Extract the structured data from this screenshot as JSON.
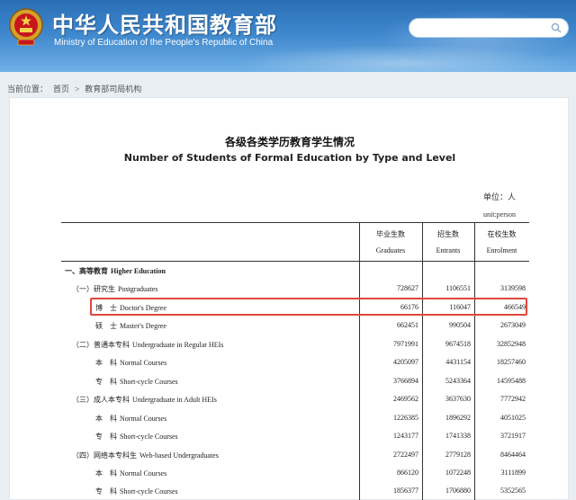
{
  "header": {
    "site_title_cn": "中华人民共和国教育部",
    "site_title_en": "Ministry of Education of the People's Republic of China",
    "search_placeholder": ""
  },
  "breadcrumb": {
    "prefix": "当前位置：",
    "items": [
      "首页",
      "教育部司局机构"
    ],
    "separator": ">"
  },
  "page": {
    "title_cn": "各级各类学历教育学生情况",
    "title_en": "Number of Students of Formal Education by Type and Level",
    "unit_cn": "单位：人",
    "unit_en": "unit:person"
  },
  "table": {
    "columns": [
      {
        "cn": "毕业生数",
        "en": "Graduates"
      },
      {
        "cn": "招生数",
        "en": "Entrants"
      },
      {
        "cn": "在校生数",
        "en": "Enrolment"
      }
    ],
    "rows": [
      {
        "label_cn": "一、高等教育",
        "label_en": "Higher Education",
        "graduates": "",
        "entrants": "",
        "enrolment": "",
        "indent": 0,
        "bold": true
      },
      {
        "label_cn": "（一）研究生",
        "label_en": "Postgraduates",
        "graduates": "728627",
        "entrants": "1106551",
        "enrolment": "3139598",
        "indent": 1,
        "bold": false
      },
      {
        "label_cn": "博　士",
        "label_en": "Doctor's Degree",
        "graduates": "66176",
        "entrants": "116047",
        "enrolment": "466549",
        "indent": 2,
        "bold": false
      },
      {
        "label_cn": "硕　士",
        "label_en": "Master's Degree",
        "graduates": "662451",
        "entrants": "990504",
        "enrolment": "2673049",
        "indent": 2,
        "bold": false
      },
      {
        "label_cn": "（二）普通本专科",
        "label_en": "Undergraduate in Regular HEIs",
        "graduates": "7971991",
        "entrants": "9674518",
        "enrolment": "32852948",
        "indent": 1,
        "bold": false
      },
      {
        "label_cn": "本　科",
        "label_en": "Normal Courses",
        "graduates": "4205097",
        "entrants": "4431154",
        "enrolment": "18257460",
        "indent": 2,
        "bold": false
      },
      {
        "label_cn": "专　科",
        "label_en": "Short-cycle Courses",
        "graduates": "3766894",
        "entrants": "5243364",
        "enrolment": "14595488",
        "indent": 2,
        "bold": false
      },
      {
        "label_cn": "（三）成人本专科",
        "label_en": "Undergraduate in Adult HEIs",
        "graduates": "2469562",
        "entrants": "3637630",
        "enrolment": "7772942",
        "indent": 1,
        "bold": false
      },
      {
        "label_cn": "本　科",
        "label_en": "Normal Courses",
        "graduates": "1226385",
        "entrants": "1896292",
        "enrolment": "4051025",
        "indent": 2,
        "bold": false
      },
      {
        "label_cn": "专　科",
        "label_en": "Short-cycle Courses",
        "graduates": "1243177",
        "entrants": "1741338",
        "enrolment": "3721917",
        "indent": 2,
        "bold": false
      },
      {
        "label_cn": "（四）网络本专科生",
        "label_en": "Web-based Undergraduates",
        "graduates": "2722497",
        "entrants": "2779128",
        "enrolment": "8464464",
        "indent": 1,
        "bold": false
      },
      {
        "label_cn": "本　科",
        "label_en": "Normal Courses",
        "graduates": "866120",
        "entrants": "1072248",
        "enrolment": "3111899",
        "indent": 2,
        "bold": false
      },
      {
        "label_cn": "专　科",
        "label_en": "Short-cycle Courses",
        "graduates": "1856377",
        "entrants": "1706880",
        "enrolment": "5352565",
        "indent": 2,
        "bold": false
      }
    ]
  },
  "colors": {
    "header_blue": "#2a6fb6",
    "highlight_red": "#e2463d"
  }
}
